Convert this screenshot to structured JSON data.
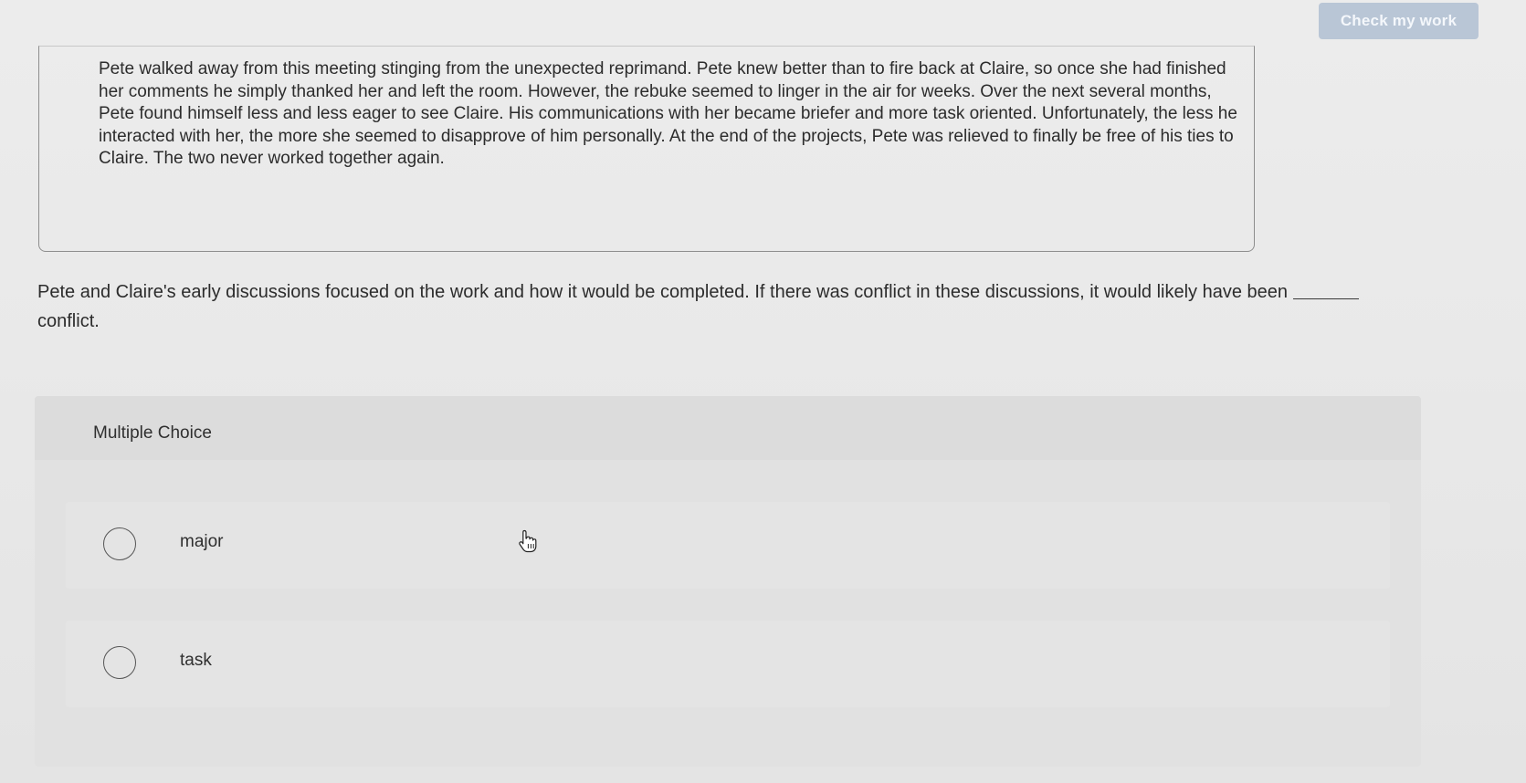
{
  "toolbar": {
    "check_label": "Check my work"
  },
  "passage": {
    "text": "Pete walked away from this meeting stinging from the unexpected reprimand. Pete knew better than to fire back at Claire, so once she had finished her comments he simply thanked her and left the room. However, the rebuke seemed to linger in the air for weeks. Over the next several months, Pete found himself less and less eager to see Claire. His communications with her became briefer and more task oriented. Unfortunately, the less he interacted with her, the more she seemed to disapprove of him personally. At the end of the projects, Pete was relieved to finally be free of his ties to Claire. The two never worked together again."
  },
  "question": {
    "text_before": "Pete and Claire's early discussions focused on the work and how it would be completed. If there was conflict in these discussions, it would likely have been",
    "text_after": "conflict."
  },
  "multiple_choice": {
    "title": "Multiple Choice",
    "options": [
      {
        "label": "major"
      },
      {
        "label": "task"
      }
    ]
  },
  "icons": {
    "cursor": "hand-pointer-icon",
    "radio": "radio-empty-icon"
  },
  "colors": {
    "button_bg": "#b9c6d6",
    "button_text": "#f4f7fb",
    "page_bg": "#ebebeb"
  }
}
